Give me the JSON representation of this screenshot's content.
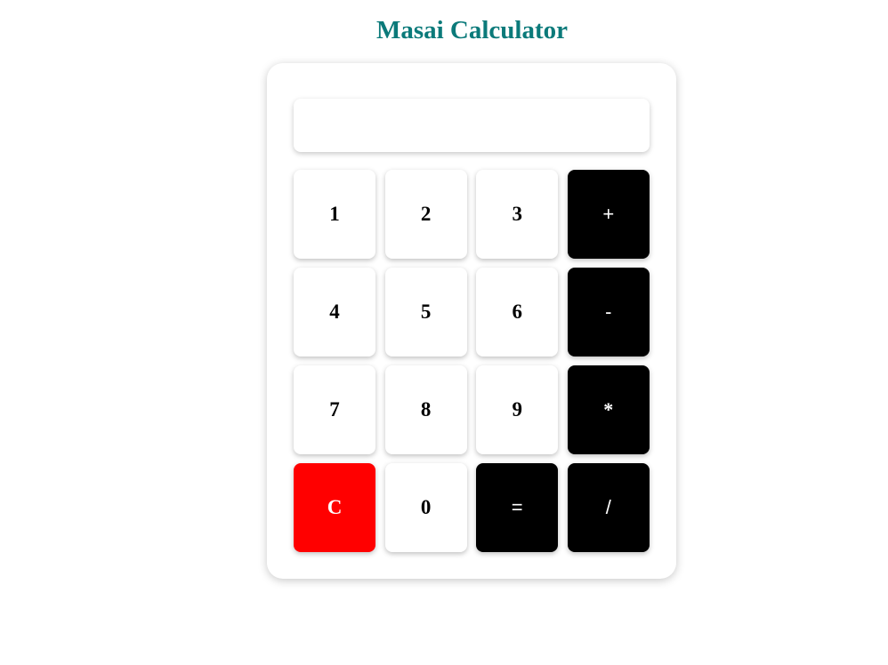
{
  "title": "Masai Calculator",
  "display": {
    "value": ""
  },
  "keys": [
    {
      "label": "1",
      "kind": "digit"
    },
    {
      "label": "2",
      "kind": "digit"
    },
    {
      "label": "3",
      "kind": "digit"
    },
    {
      "label": "+",
      "kind": "operator"
    },
    {
      "label": "4",
      "kind": "digit"
    },
    {
      "label": "5",
      "kind": "digit"
    },
    {
      "label": "6",
      "kind": "digit"
    },
    {
      "label": "-",
      "kind": "operator"
    },
    {
      "label": "7",
      "kind": "digit"
    },
    {
      "label": "8",
      "kind": "digit"
    },
    {
      "label": "9",
      "kind": "digit"
    },
    {
      "label": "*",
      "kind": "operator"
    },
    {
      "label": "C",
      "kind": "clear"
    },
    {
      "label": "0",
      "kind": "digit"
    },
    {
      "label": "=",
      "kind": "operator"
    },
    {
      "label": "/",
      "kind": "operator"
    }
  ],
  "colors": {
    "title": "#0b7a7a",
    "digit_bg": "#ffffff",
    "operator_bg": "#000000",
    "clear_bg": "#ff0000"
  }
}
